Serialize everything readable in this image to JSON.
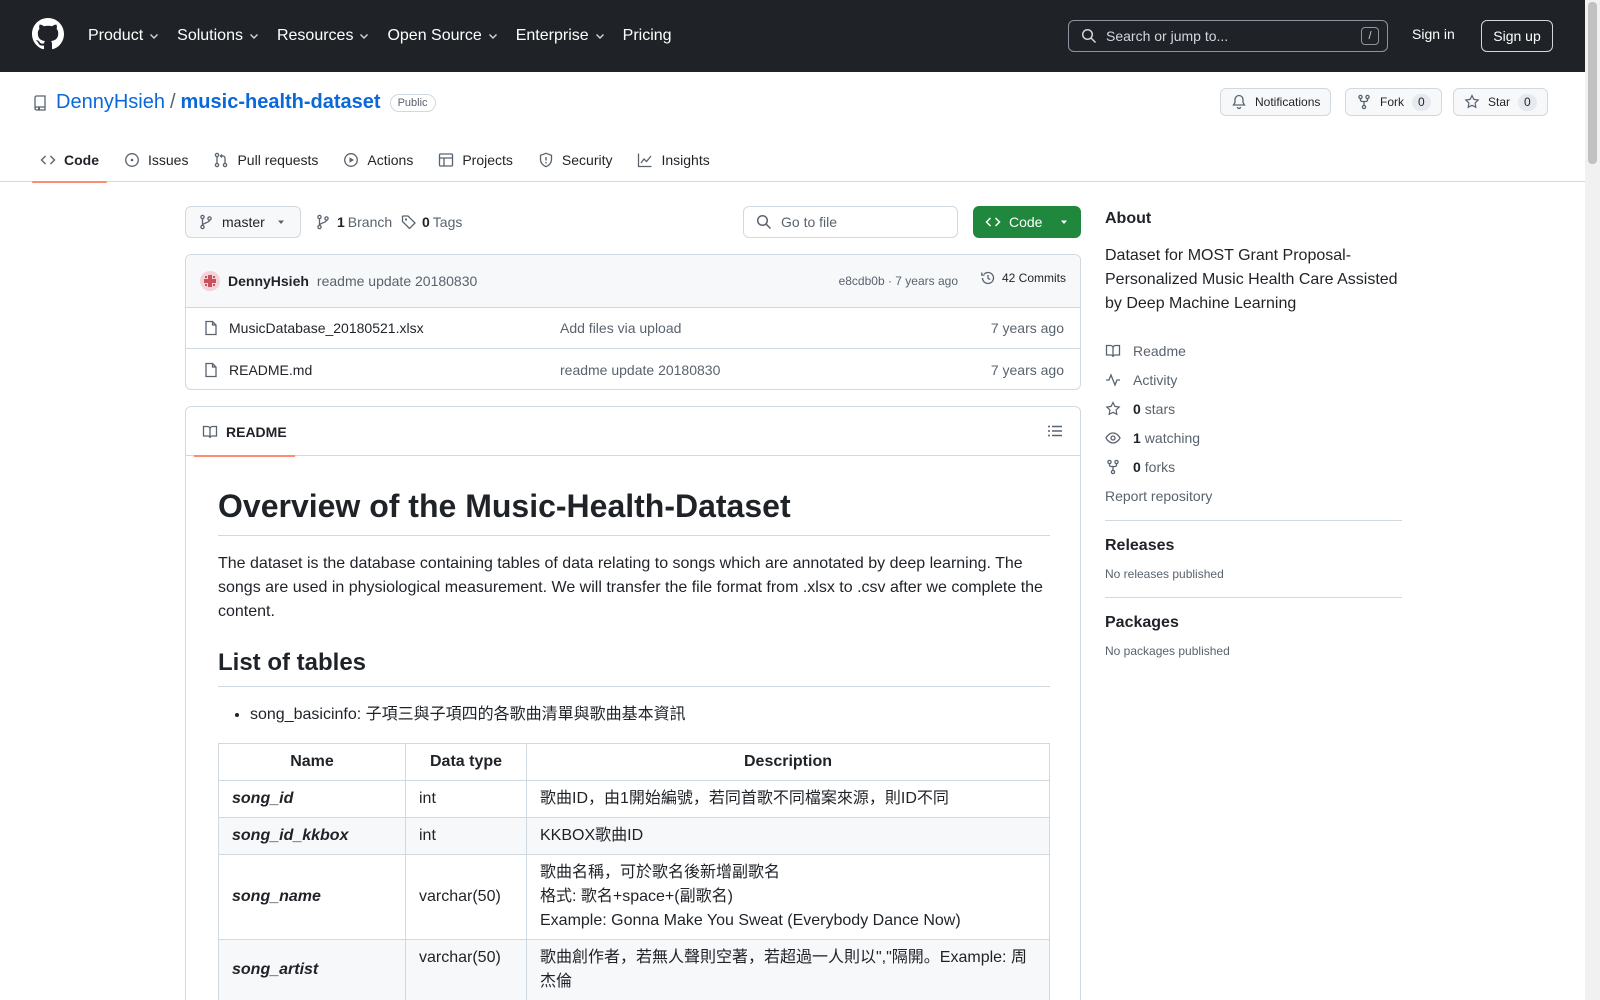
{
  "header": {
    "nav": [
      "Product",
      "Solutions",
      "Resources",
      "Open Source",
      "Enterprise",
      "Pricing"
    ],
    "search_placeholder": "Search or jump to...",
    "search_shortcut": "/",
    "signin": "Sign in",
    "signup": "Sign up"
  },
  "repo": {
    "owner": "DennyHsieh",
    "separator": "/",
    "name": "music-health-dataset",
    "visibility": "Public",
    "notifications": "Notifications",
    "fork_label": "Fork",
    "fork_count": "0",
    "star_label": "Star",
    "star_count": "0",
    "tabs": [
      "Code",
      "Issues",
      "Pull requests",
      "Actions",
      "Projects",
      "Security",
      "Insights"
    ]
  },
  "toolbar": {
    "branch": "master",
    "branch_count": "1",
    "branch_label": "Branch",
    "tag_count": "0",
    "tag_label": "Tags",
    "go_to_file": "Go to file",
    "code_button": "Code"
  },
  "commit": {
    "author": "DennyHsieh",
    "message": "readme update 20180830",
    "meta": "e8cdb0b · 7 years ago",
    "commits": "42 Commits"
  },
  "files": [
    {
      "name": "MusicDatabase_20180521.xlsx",
      "message": "Add files via upload",
      "age": "7 years ago"
    },
    {
      "name": "README.md",
      "message": "readme update 20180830",
      "age": "7 years ago"
    }
  ],
  "readme": {
    "tab": "README",
    "h1": "Overview of the Music-Health-Dataset",
    "intro": "The dataset is the database containing tables of data relating to songs which are annotated by deep learning. The songs are used in physiological measurement. We will transfer the file format from .xlsx to .csv after we complete the content.",
    "h2": "List of tables",
    "bullet": "song_basicinfo: 子項三與子項四的各歌曲清單與歌曲基本資訊",
    "table_headers": [
      "Name",
      "Data type",
      "Description"
    ],
    "rows": [
      {
        "name": "song_id",
        "type": "int",
        "desc": [
          "歌曲ID，由1開始編號，若同首歌不同檔案來源，則ID不同"
        ]
      },
      {
        "name": "song_id_kkbox",
        "type": "int",
        "desc": [
          "KKBOX歌曲ID"
        ]
      },
      {
        "name": "song_name",
        "type": "varchar(50)",
        "desc": [
          "歌曲名稱，可於歌名後新增副歌名",
          "格式: 歌名+space+(副歌名)",
          "Example: Gonna Make You Sweat (Everybody Dance Now)"
        ]
      },
      {
        "name": "song_artist",
        "type": "varchar(50)",
        "desc": [
          "歌曲創作者，若無人聲則空著，若超過一人則以\",\"隔開。Example: 周杰倫"
        ]
      }
    ]
  },
  "about": {
    "title": "About",
    "description": "Dataset for MOST Grant Proposal-Personalized Music Health Care Assisted by Deep Machine Learning",
    "readme": "Readme",
    "activity": "Activity",
    "stars_count": "0",
    "stars_label": "stars",
    "watching_count": "1",
    "watching_label": "watching",
    "forks_count": "0",
    "forks_label": "forks",
    "report": "Report repository",
    "releases_title": "Releases",
    "releases_empty": "No releases published",
    "packages_title": "Packages",
    "packages_empty": "No packages published"
  },
  "colors": {
    "header_bg": "#1f2328",
    "link": "#0969da",
    "code_button": "#1f883d",
    "active_tab_underline": "#fd8c73"
  }
}
